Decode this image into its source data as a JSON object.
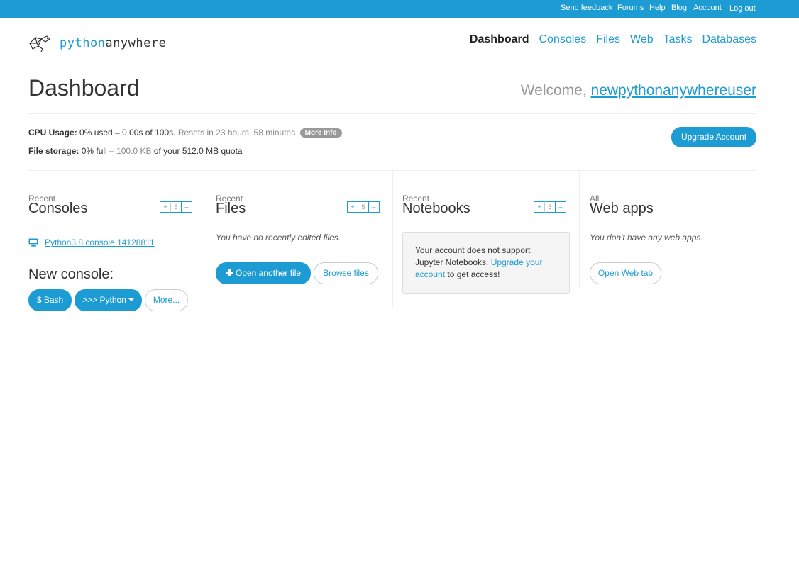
{
  "topbar": {
    "links": [
      "Send feedback",
      "Forums",
      "Help",
      "Blog",
      "Account",
      "Log out"
    ]
  },
  "logo": {
    "part1": "python",
    "part2": "anywhere"
  },
  "nav": {
    "items": [
      "Dashboard",
      "Consoles",
      "Files",
      "Web",
      "Tasks",
      "Databases"
    ],
    "active": "Dashboard"
  },
  "title": "Dashboard",
  "welcome": {
    "prefix": "Welcome, ",
    "username": "newpythonanywhereuser"
  },
  "usage": {
    "cpu_label": "CPU Usage:",
    "cpu_value": "0% used – 0.00s of 100s.",
    "cpu_reset": "Resets in 23 hours, 58 minutes",
    "more_info": "More Info",
    "storage_label": "File storage:",
    "storage_pct": "0% full –",
    "storage_used": "100.0 KB",
    "storage_quota": "of your 512.0 MB quota"
  },
  "upgrade_button": "Upgrade Account",
  "stepper": {
    "plus": "+",
    "count": "5",
    "minus": "–"
  },
  "consoles": {
    "small": "Recent",
    "big": "Consoles",
    "recent_item": "Python3.8 console 14128811",
    "new_heading": "New console:",
    "buttons": {
      "bash": "$ Bash",
      "python": ">>> Python",
      "more": "More..."
    }
  },
  "files": {
    "small": "Recent",
    "big": "Files",
    "empty": "You have no recently edited files.",
    "open_button": "Open another file",
    "browse_button": "Browse files"
  },
  "notebooks": {
    "small": "Recent",
    "big": "Notebooks",
    "notice_text": "Your account does not support Jupyter Notebooks.",
    "notice_link": "Upgrade your account",
    "notice_suffix": "to get access!"
  },
  "webapps": {
    "small": "All",
    "big": "Web apps",
    "empty": "You don't have any web apps.",
    "open_button": "Open Web tab"
  },
  "colors": {
    "accent": "#1d9cd3",
    "muted": "#999999"
  }
}
